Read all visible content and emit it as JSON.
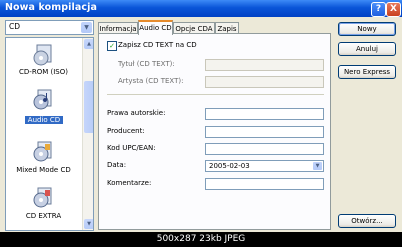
{
  "window": {
    "title": "Nowa kompilacja",
    "help_button": "?",
    "close_button": "X"
  },
  "type_select": {
    "value": "CD"
  },
  "type_list": {
    "items": [
      {
        "label": "CD-ROM (ISO)",
        "icon": "cd-rom-iso-icon",
        "selected": false
      },
      {
        "label": "Audio CD",
        "icon": "audio-cd-icon",
        "selected": true
      },
      {
        "label": "Mixed Mode CD",
        "icon": "mixed-mode-cd-icon",
        "selected": false
      },
      {
        "label": "CD EXTRA",
        "icon": "cd-extra-icon",
        "selected": false
      }
    ]
  },
  "tabs": [
    {
      "label": "Informacja",
      "active": false
    },
    {
      "label": "Audio CD",
      "active": true
    },
    {
      "label": "Opcje CDA",
      "active": false
    },
    {
      "label": "Zapis",
      "active": false
    }
  ],
  "form": {
    "write_cd_text": {
      "label": "Zapisz CD TEXT na CD",
      "checked": true
    },
    "title_label": "Tytuł (CD TEXT):",
    "title_value": "",
    "artist_label": "Artysta (CD TEXT):",
    "artist_value": "",
    "copyright_label": "Prawa autorskie:",
    "copyright_value": "",
    "producer_label": "Producent:",
    "producer_value": "",
    "upc_label": "Kod UPC/EAN:",
    "upc_value": "",
    "date_label": "Data:",
    "date_value": "2005-02-03",
    "comment_label": "Komentarze:",
    "comment_value": ""
  },
  "buttons": {
    "new": "Nowy",
    "cancel": "Anuluj",
    "nero_express": "Nero Express",
    "open": "Otwórz..."
  },
  "footer": {
    "caption": "500x287 23kb JPEG"
  },
  "colors": {
    "titlebar": "#0a55d8",
    "selection": "#316ac5",
    "tab_highlight": "#e68b2c",
    "dialog_bg": "#ece9d8"
  }
}
